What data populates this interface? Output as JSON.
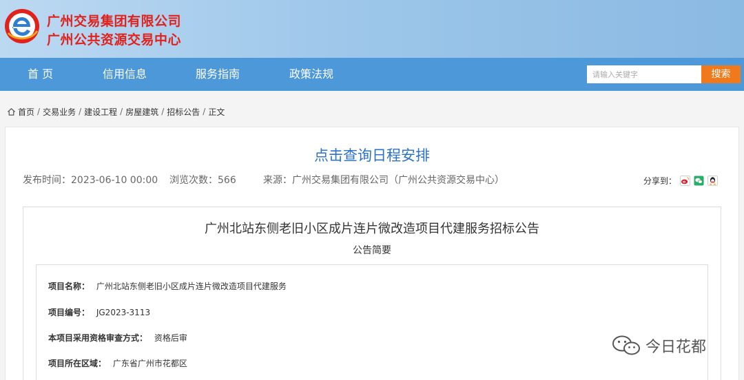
{
  "header": {
    "org_line1": "广州交易集团有限公司",
    "org_line2": "广州公共资源交易中心",
    "logo_icon": "e-logo-icon",
    "brand_red": "#e0211c",
    "nav_blue": "#4c98d8"
  },
  "nav": {
    "items": [
      "首 页",
      "信用信息",
      "服务指南",
      "政策法规"
    ]
  },
  "search": {
    "placeholder": "请输入关键字",
    "button_label": "搜索",
    "button_color": "#f07a1b"
  },
  "breadcrumb": {
    "items": [
      "首页",
      "交易业务",
      "建设工程",
      "房屋建筑",
      "招标公告",
      "正文"
    ],
    "separator": "/"
  },
  "article": {
    "schedule_link": "点击查询日程安排",
    "publish_time": "发布时间：2023-06-10 00:00",
    "views": "浏览次数：566",
    "source": "来源：广州交易集团有限公司（广州公共资源交易中心）",
    "share_label": "分享到：",
    "share_icons": [
      "weibo-icon",
      "wechat-icon",
      "qq-icon"
    ]
  },
  "notice": {
    "title": "广州北站东侧老旧小区成片连片微改造项目代建服务招标公告",
    "subtitle": "公告简要",
    "fields": [
      {
        "label": "项目名称：",
        "value": "广州北站东侧老旧小区成片连片微改造项目代建服务"
      },
      {
        "label": "项目编号：",
        "value": "JG2023-3113"
      },
      {
        "label": "本项目采用资格审查方式：",
        "value": "资格后审"
      },
      {
        "label": "项目所在区域：",
        "value": "广东省广州市花都区"
      }
    ]
  },
  "watermark": {
    "text": "今日花都",
    "icon": "wechat-icon"
  }
}
